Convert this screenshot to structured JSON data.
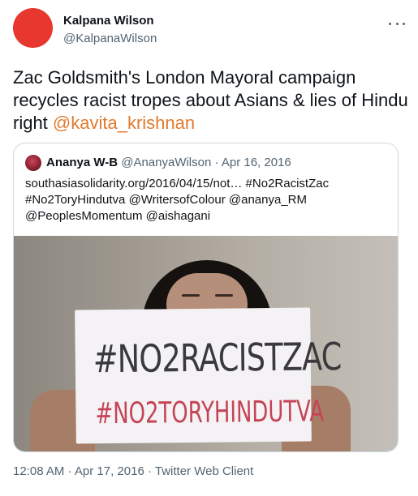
{
  "colors": {
    "avatar": "#e8372e",
    "mention": "#e07a2e",
    "secondary_text": "#536471"
  },
  "author": {
    "name": "Kalpana Wilson",
    "handle": "@KalpanaWilson"
  },
  "more_icon": "more-horizontal-icon",
  "tweet": {
    "text": "Zac Goldsmith's London Mayoral campaign recycles racist tropes about Asians & lies of Hindu right ",
    "mention": "@kavita_krishnan"
  },
  "quote": {
    "name": "Ananya W-B",
    "handle": "@AnanyaWilson",
    "separator": " · ",
    "date": "Apr 16, 2016",
    "lines": [
      "southasiasolidarity.org/2016/04/15/not… #No2RacistZac",
      "#No2ToryHindutva @WritersofColour @ananya_RM",
      "@PeoplesMomentum @aishagani"
    ],
    "image": {
      "sign_line1": "#NO2RACISTZAC",
      "sign_line2": "#NO2TORYHINDUTVA"
    }
  },
  "meta": {
    "time": "12:08 AM",
    "sep1": " · ",
    "date": "Apr 17, 2016",
    "sep2": " · ",
    "client": "Twitter Web Client"
  }
}
